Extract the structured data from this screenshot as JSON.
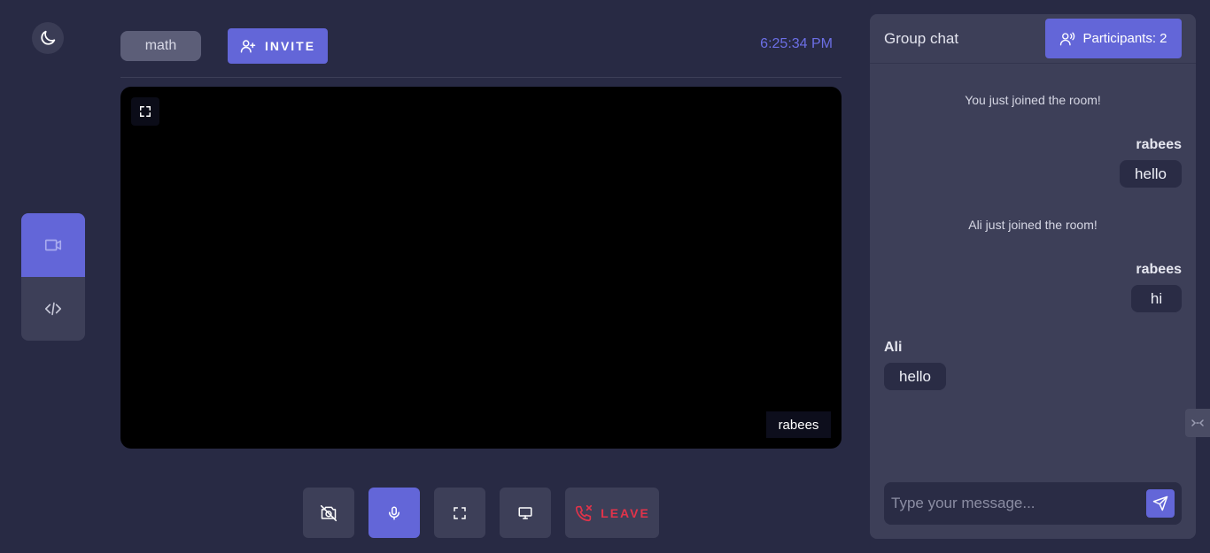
{
  "sidebar": {
    "theme_icon": "moon-icon",
    "tools": [
      {
        "icon": "video-camera-icon",
        "active": true
      },
      {
        "icon": "code-icon",
        "active": false
      }
    ]
  },
  "header": {
    "room_name": "math",
    "invite_label": "INVITE",
    "time": "6:25:34 PM"
  },
  "video": {
    "participant_name": "rabees"
  },
  "controls": {
    "leave_label": "LEAVE",
    "buttons": [
      "camera-off-icon",
      "microphone-icon",
      "fullscreen-icon",
      "screen-share-icon",
      "leave-call-icon"
    ]
  },
  "chat": {
    "title": "Group chat",
    "participants_label": "Participants: 2",
    "system_messages": [
      "You just joined the room!",
      "Ali just joined the room!"
    ],
    "messages": [
      {
        "sender": "rabees",
        "text": "hello",
        "side": "right"
      },
      {
        "sender": "rabees",
        "text": "hi",
        "side": "right"
      },
      {
        "sender": "Ali",
        "text": "hello",
        "side": "left"
      }
    ],
    "input_placeholder": "Type your message..."
  },
  "colors": {
    "background": "#282a44",
    "panel": "#3d3f58",
    "accent": "#6366d8",
    "danger": "#e2334a"
  }
}
